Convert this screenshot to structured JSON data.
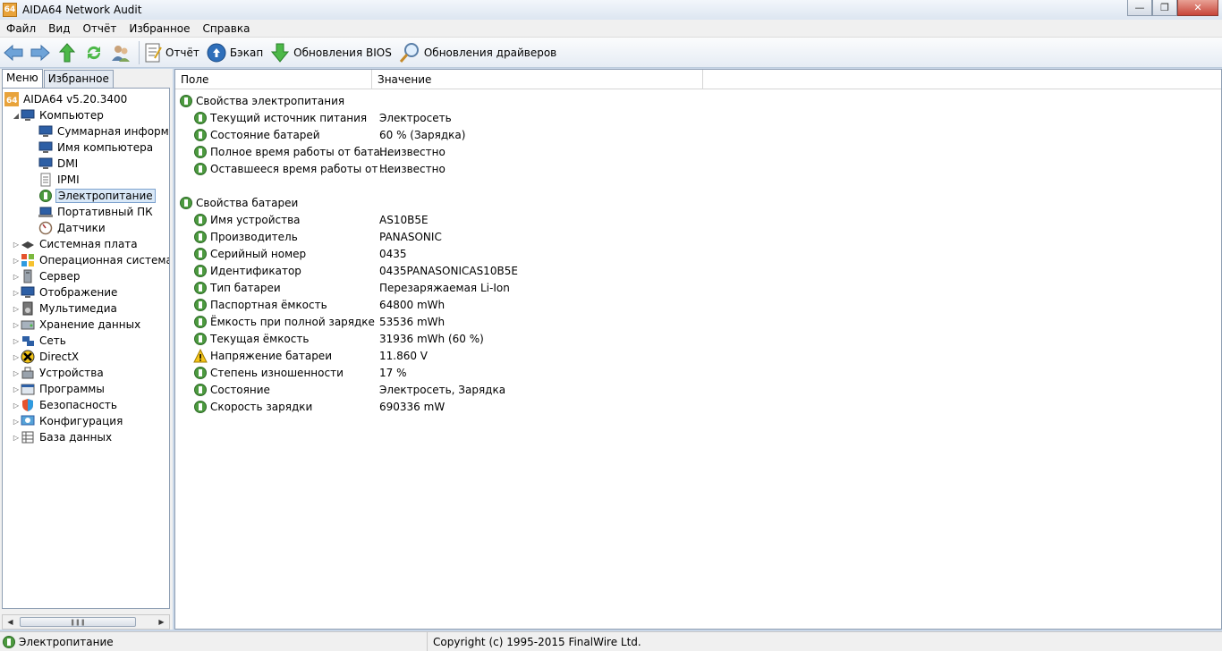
{
  "window": {
    "title": "AIDA64 Network Audit",
    "app_icon_text": "64"
  },
  "menu": [
    "Файл",
    "Вид",
    "Отчёт",
    "Избранное",
    "Справка"
  ],
  "toolbar": {
    "report": "Отчёт",
    "backup": "Бэкап",
    "bios_updates": "Обновления BIOS",
    "driver_updates": "Обновления драйверов"
  },
  "tabs": [
    "Меню",
    "Избранное"
  ],
  "tree": {
    "root": "AIDA64 v5.20.3400",
    "computer": "Компьютер",
    "computer_children": [
      "Суммарная информация",
      "Имя компьютера",
      "DMI",
      "IPMI",
      "Электропитание",
      "Портативный ПК",
      "Датчики"
    ],
    "categories": [
      "Системная плата",
      "Операционная система",
      "Сервер",
      "Отображение",
      "Мультимедиа",
      "Хранение данных",
      "Сеть",
      "DirectX",
      "Устройства",
      "Программы",
      "Безопасность",
      "Конфигурация",
      "База данных"
    ]
  },
  "columns": {
    "field": "Поле",
    "value": "Значение"
  },
  "groups": {
    "power": {
      "title": "Свойства электропитания",
      "rows": [
        {
          "field": "Текущий источник питания",
          "value": "Электросеть"
        },
        {
          "field": "Состояние батарей",
          "value": "60 % (Зарядка)"
        },
        {
          "field": "Полное время работы от бата...",
          "value": "Неизвестно"
        },
        {
          "field": "Оставшееся время работы от ...",
          "value": "Неизвестно"
        }
      ]
    },
    "battery": {
      "title": "Свойства батареи",
      "rows": [
        {
          "field": "Имя устройства",
          "value": "AS10B5E"
        },
        {
          "field": "Производитель",
          "value": "PANASONIC"
        },
        {
          "field": "Серийный номер",
          "value": "0435"
        },
        {
          "field": "Идентификатор",
          "value": "0435PANASONICAS10B5E"
        },
        {
          "field": "Тип батареи",
          "value": "Перезаряжаемая Li-Ion"
        },
        {
          "field": "Паспортная ёмкость",
          "value": "64800 mWh"
        },
        {
          "field": "Ёмкость при полной зарядке",
          "value": "53536 mWh"
        },
        {
          "field": "Текущая ёмкость",
          "value": "31936 mWh  (60 %)"
        },
        {
          "field": "Напряжение батареи",
          "value": "11.860 V"
        },
        {
          "field": "Степень изношенности",
          "value": "17 %"
        },
        {
          "field": "Состояние",
          "value": "Электросеть, Зарядка"
        },
        {
          "field": "Скорость зарядки",
          "value": "690336 mW"
        }
      ]
    }
  },
  "status": {
    "left": "Электропитание",
    "right": "Copyright (c) 1995-2015 FinalWire Ltd."
  },
  "colors": {
    "accent": "#3399ff",
    "titlebar": "#dde6f1",
    "selection": "#d9e8f7"
  }
}
